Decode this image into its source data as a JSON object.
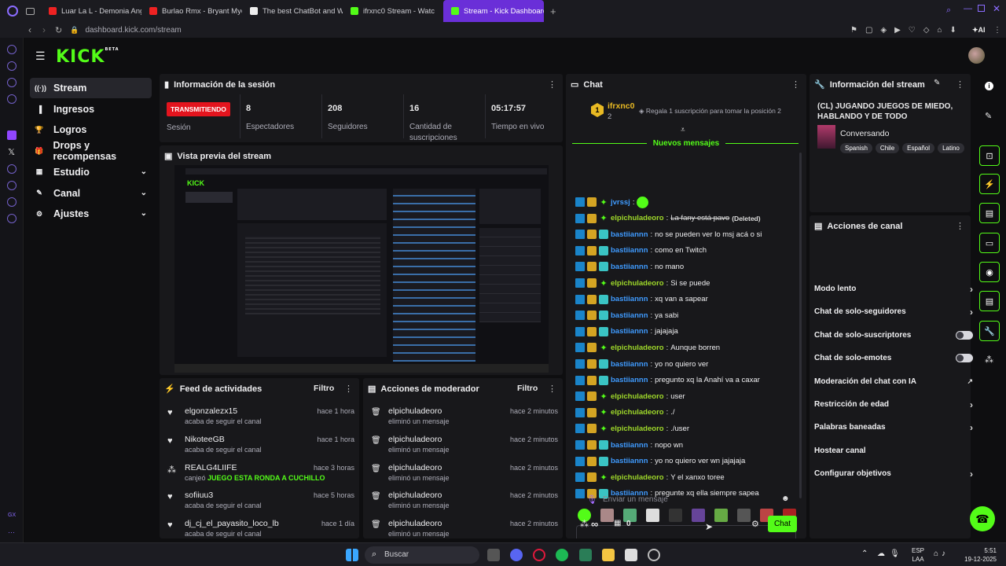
{
  "browser": {
    "tabs": [
      {
        "title": "Luar La L - Demonia Ange",
        "color": "#e22"
      },
      {
        "title": "Burlao Rmx - Bryant Myer",
        "color": "#e22"
      },
      {
        "title": "The best ChatBot and Wi",
        "color": "#eee"
      },
      {
        "title": "ifrxnc0 Stream - Watc",
        "color": "#53fc18"
      },
      {
        "title": "Stream - Kick Dashboard",
        "color": "#53fc18"
      }
    ],
    "url": "dashboard.kick.com/stream"
  },
  "app": {
    "logo": "KICK",
    "logo_badge": "BETA",
    "nav": [
      {
        "label": "Stream",
        "icon": "broadcast-icon",
        "glyph": "((·))",
        "selected": true,
        "expandable": false
      },
      {
        "label": "Ingresos",
        "icon": "chart-icon",
        "glyph": "▐",
        "selected": false,
        "expandable": false
      },
      {
        "label": "Logros",
        "icon": "trophy-icon",
        "glyph": "🏆",
        "selected": false,
        "expandable": false
      },
      {
        "label": "Drops y recompensas",
        "icon": "gift-icon",
        "glyph": "🎁",
        "selected": false,
        "expandable": false
      },
      {
        "label": "Estudio",
        "icon": "grid-icon",
        "glyph": "▦",
        "selected": false,
        "expandable": true
      },
      {
        "label": "Canal",
        "icon": "pencil-icon",
        "glyph": "✎",
        "selected": false,
        "expandable": true
      },
      {
        "label": "Ajustes",
        "icon": "gear-icon",
        "glyph": "⚙",
        "selected": false,
        "expandable": true
      }
    ]
  },
  "session": {
    "title": "Información de la sesión",
    "badge": "TRANSMITIENDO",
    "badge_label": "Sesión",
    "stats": [
      {
        "value": "8",
        "label": "Espectadores"
      },
      {
        "value": "208",
        "label": "Seguidores"
      },
      {
        "value": "16",
        "label": "Cantidad de suscripciones"
      },
      {
        "value": "05:17:57",
        "label": "Tiempo en vivo"
      }
    ]
  },
  "preview": {
    "title": "Vista previa del stream"
  },
  "feed": {
    "title": "Feed de actividades",
    "filter": "Filtro",
    "items": [
      {
        "name": "elgonzalezx15",
        "sub": "acaba de seguir el canal",
        "sub_highlight": "",
        "time": "hace 1 hora",
        "icon": "heart-icon",
        "glyph": "♥"
      },
      {
        "name": "NikoteeGB",
        "sub": "acaba de seguir el canal",
        "sub_highlight": "",
        "time": "hace 1 hora",
        "icon": "heart-icon",
        "glyph": "♥"
      },
      {
        "name": "REALG4LIIFE",
        "sub": "canjeó",
        "sub_highlight": "JUEGO ESTA RONDA A CUCHILLO",
        "time": "hace 3 horas",
        "icon": "points-icon",
        "glyph": "⁂"
      },
      {
        "name": "sofiiuu3",
        "sub": "acaba de seguir el canal",
        "sub_highlight": "",
        "time": "hace 5 horas",
        "icon": "heart-icon",
        "glyph": "♥"
      },
      {
        "name": "dj_cj_el_payasito_loco_lb",
        "sub": "acaba de seguir el canal",
        "sub_highlight": "",
        "time": "hace 1 día",
        "icon": "heart-icon",
        "glyph": "♥"
      }
    ]
  },
  "modactions": {
    "title": "Acciones de moderador",
    "filter": "Filtro",
    "items": [
      {
        "name": "elpichuladeoro",
        "sub": "eliminó un mensaje",
        "time": "hace 2 minutos"
      },
      {
        "name": "elpichuladeoro",
        "sub": "eliminó un mensaje",
        "time": "hace 2 minutos"
      },
      {
        "name": "elpichuladeoro",
        "sub": "eliminó un mensaje",
        "time": "hace 2 minutos"
      },
      {
        "name": "elpichuladeoro",
        "sub": "eliminó un mensaje",
        "time": "hace 2 minutos"
      },
      {
        "name": "elpichuladeoro",
        "sub": "eliminó un mensaje",
        "time": "hace 2 minutos"
      }
    ]
  },
  "chat": {
    "title": "Chat",
    "pinned_user": "ifrxnc0",
    "pinned_rank": "1",
    "pinned_count": "2",
    "pinned_text": "Regala 1 suscripción para tomar la posición 2",
    "new_messages": "Nuevos mensajes",
    "messages": [
      {
        "user": "jvrssj",
        "color": "blue",
        "badges": [
          "b1",
          "b2",
          "b4"
        ],
        "text": "",
        "deleted": false
      },
      {
        "user": "elpichuladeoro",
        "color": "green",
        "badges": [
          "b1",
          "b2",
          "b4"
        ],
        "text": "La fany está pavo",
        "deleted": true,
        "deleted_label": "(Deleted)"
      },
      {
        "user": "bastiiannn",
        "color": "blue",
        "badges": [
          "b1",
          "b2",
          "b3"
        ],
        "text": "no se pueden ver lo msj acá o si",
        "deleted": false
      },
      {
        "user": "bastiiannn",
        "color": "blue",
        "badges": [
          "b1",
          "b2",
          "b3"
        ],
        "text": "como en Twitch",
        "deleted": false
      },
      {
        "user": "bastiiannn",
        "color": "blue",
        "badges": [
          "b1",
          "b2",
          "b3"
        ],
        "text": "no mano",
        "deleted": false
      },
      {
        "user": "elpichuladeoro",
        "color": "green",
        "badges": [
          "b1",
          "b2",
          "b4"
        ],
        "text": "Si se puede",
        "deleted": false
      },
      {
        "user": "bastiiannn",
        "color": "blue",
        "badges": [
          "b1",
          "b2",
          "b3"
        ],
        "text": "xq van a sapear",
        "deleted": false
      },
      {
        "user": "bastiiannn",
        "color": "blue",
        "badges": [
          "b1",
          "b2",
          "b3"
        ],
        "text": "ya sabi",
        "deleted": false
      },
      {
        "user": "bastiiannn",
        "color": "blue",
        "badges": [
          "b1",
          "b2",
          "b3"
        ],
        "text": "jajajaja",
        "deleted": false
      },
      {
        "user": "elpichuladeoro",
        "color": "green",
        "badges": [
          "b1",
          "b2",
          "b4"
        ],
        "text": "Aunque borren",
        "deleted": false
      },
      {
        "user": "bastiiannn",
        "color": "blue",
        "badges": [
          "b1",
          "b2",
          "b3"
        ],
        "text": "yo no quiero ver",
        "deleted": false
      },
      {
        "user": "bastiiannn",
        "color": "blue",
        "badges": [
          "b1",
          "b2",
          "b3"
        ],
        "text": "pregunto xq la Anahí va a caxar",
        "deleted": false
      },
      {
        "user": "elpichuladeoro",
        "color": "green",
        "badges": [
          "b1",
          "b2",
          "b4"
        ],
        "text": "user",
        "deleted": false
      },
      {
        "user": "elpichuladeoro",
        "color": "green",
        "badges": [
          "b1",
          "b2",
          "b4"
        ],
        "text": "./",
        "deleted": false
      },
      {
        "user": "elpichuladeoro",
        "color": "green",
        "badges": [
          "b1",
          "b2",
          "b4"
        ],
        "text": "./user",
        "deleted": false
      },
      {
        "user": "bastiiannn",
        "color": "blue",
        "badges": [
          "b1",
          "b2",
          "b3"
        ],
        "text": "nopo wn",
        "deleted": false
      },
      {
        "user": "bastiiannn",
        "color": "blue",
        "badges": [
          "b1",
          "b2",
          "b3"
        ],
        "text": "yo no quiero ver wn jajajaja",
        "deleted": false
      },
      {
        "user": "elpichuladeoro",
        "color": "green",
        "badges": [
          "b1",
          "b2",
          "b4"
        ],
        "text": "Y el xanxo toree",
        "deleted": false
      },
      {
        "user": "bastiiannn",
        "color": "blue",
        "badges": [
          "b1",
          "b2",
          "b3"
        ],
        "text": "pregunte xq ella siempre sapea",
        "deleted": false
      }
    ],
    "placeholder": "Enviar un mensaje",
    "points": "∞",
    "pinned_count_bottom": "0",
    "send": "Chat"
  },
  "streaminfo": {
    "title": "Información del stream",
    "stream_title": "(CL) JUGANDO JUEGOS DE MIEDO, HABLANDO Y DE TODO",
    "category": "Conversando",
    "tags": [
      "Spanish",
      "Chile",
      "Español",
      "Latino"
    ]
  },
  "channel_actions": {
    "title": "Acciones de canal",
    "items": [
      {
        "label": "Modo lento",
        "kind": "chevron"
      },
      {
        "label": "Chat de solo-seguidores",
        "kind": "chevron"
      },
      {
        "label": "Chat de solo-suscriptores",
        "kind": "toggle"
      },
      {
        "label": "Chat de solo-emotes",
        "kind": "toggle"
      },
      {
        "label": "Moderación del chat con IA",
        "kind": "external"
      },
      {
        "label": "Restricción de edad",
        "kind": "chevron"
      },
      {
        "label": "Palabras baneadas",
        "kind": "chevron"
      },
      {
        "label": "Hostear canal",
        "kind": "none"
      },
      {
        "label": "Configurar objetivos",
        "kind": "chevron"
      }
    ]
  },
  "taskbar": {
    "search": "Buscar",
    "lang": "ESP",
    "lang2": "LAA",
    "time": "5:51",
    "date": "19-12-2025"
  }
}
